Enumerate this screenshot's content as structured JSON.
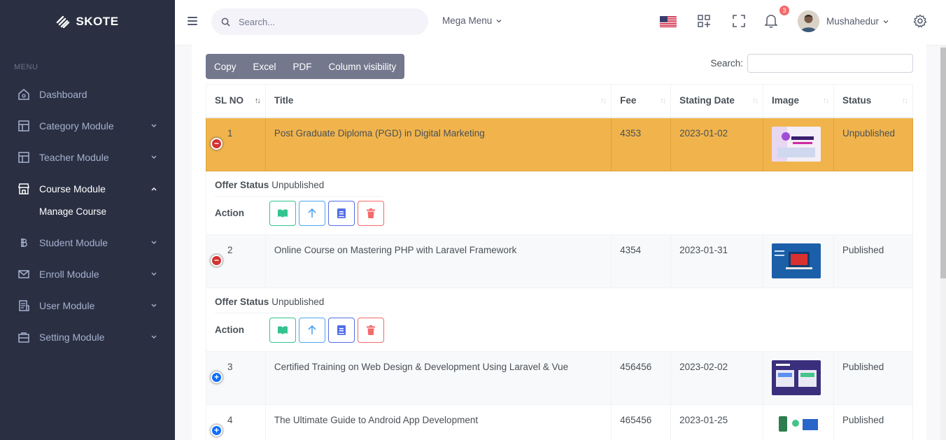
{
  "brand": {
    "name": "SKOTE"
  },
  "sidebar": {
    "menu_title": "MENU",
    "items": [
      {
        "label": "Dashboard",
        "icon": "home-icon"
      },
      {
        "label": "Category Module",
        "icon": "layout-icon"
      },
      {
        "label": "Teacher Module",
        "icon": "layout-icon"
      },
      {
        "label": "Course Module",
        "icon": "store-icon"
      },
      {
        "label": "Student Module",
        "icon": "bitcoin-icon"
      },
      {
        "label": "Enroll Module",
        "icon": "envelope-icon"
      },
      {
        "label": "User Module",
        "icon": "receipt-icon"
      },
      {
        "label": "Setting Module",
        "icon": "briefcase-icon"
      }
    ],
    "sub_item": "Manage Course"
  },
  "topbar": {
    "search_placeholder": "Search...",
    "mega_menu": "Mega Menu",
    "notification_count": "3",
    "username": "Mushahedur"
  },
  "toolbar": {
    "copy": "Copy",
    "excel": "Excel",
    "pdf": "PDF",
    "column_visibility": "Column visibility",
    "search_label": "Search:"
  },
  "table": {
    "headers": [
      "SL NO",
      "Title",
      "Fee",
      "Stating Date",
      "Image",
      "Status"
    ],
    "rows": [
      {
        "sl": "1",
        "title": "Post Graduate Diploma (PGD) in Digital Marketing",
        "fee": "4353",
        "date": "2023-01-02",
        "status": "Unpublished",
        "offer_status": "Unpublished"
      },
      {
        "sl": "2",
        "title": "Online Course on Mastering PHP with Laravel Framework",
        "fee": "4354",
        "date": "2023-01-31",
        "status": "Published",
        "offer_status": "Unpublished"
      },
      {
        "sl": "3",
        "title": "Certified Training on Web Design & Development Using Laravel & Vue",
        "fee": "456456",
        "date": "2023-02-02",
        "status": "Published"
      },
      {
        "sl": "4",
        "title": "The Ultimate Guide to Android App Development",
        "fee": "465456",
        "date": "2023-01-25",
        "status": "Published"
      }
    ],
    "child_labels": {
      "offer_status": "Offer Status",
      "action": "Action"
    }
  },
  "colors": {
    "sidebar_bg": "#2a3042",
    "highlight_row": "#f1b44c",
    "success": "#34c38f",
    "info": "#50a5f1",
    "primary": "#556ee6",
    "danger": "#f46a6a"
  }
}
